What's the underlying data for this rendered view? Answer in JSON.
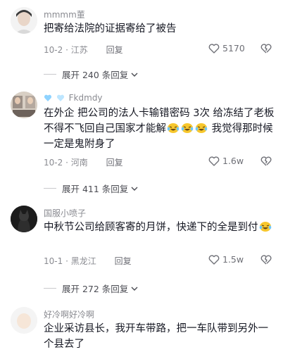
{
  "comments": [
    {
      "username": "mmmm董",
      "text": "把寄给法院的证据寄给了被告",
      "date": "10-2",
      "location": "江苏",
      "reply_label": "回复",
      "likes": "5170",
      "expand_label": "展开 240 条回复"
    },
    {
      "username": "Fkdmdy",
      "text_part1": "在外企 把公司的法人卡输错密码 3次 给冻结了老板不得不飞回自己国家才能解",
      "text_part2": " 我觉得那时候一定是鬼附身了",
      "date": "10-2",
      "location": "河南",
      "reply_label": "回复",
      "likes": "1.6w",
      "expand_label": "展开 411 条回复"
    },
    {
      "username": "国服小喷子",
      "text_part1": "中秋节公司给顾客寄的月饼，快递下的全是到付",
      "date": "10-1",
      "location": "黑龙江",
      "reply_label": "回复",
      "likes": "1.5w",
      "expand_label": "展开 272 条回复"
    },
    {
      "username": "好冷啊好冷啊",
      "text": "企业采访县长，我开车带路，把一车队带到另外一个县去了"
    }
  ],
  "separator": "·",
  "icons": {
    "like": "heart-outline-icon",
    "dislike": "broken-heart-icon",
    "expand": "chevron-down-icon",
    "emoji": "laughing-tears-emoji"
  }
}
